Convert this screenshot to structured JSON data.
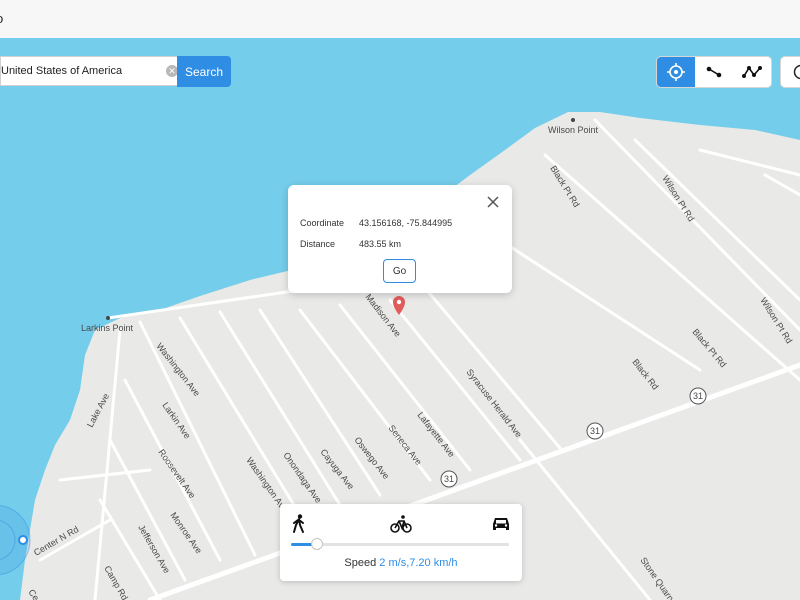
{
  "window": {
    "title_fragment": "o"
  },
  "search": {
    "value": "United States of America",
    "button_label": "Search"
  },
  "modes": {
    "items": [
      {
        "name": "teleport-mode",
        "icon": "crosshair-icon",
        "active": true
      },
      {
        "name": "two-spot-mode",
        "icon": "two-spot-route-icon",
        "active": false
      },
      {
        "name": "multi-spot-mode",
        "icon": "multi-spot-route-icon",
        "active": false
      }
    ]
  },
  "popup": {
    "coordinate_label": "Coordinate",
    "coordinate_value": "43.156168, -75.844995",
    "distance_label": "Distance",
    "distance_value": "483.55 km",
    "go_label": "Go"
  },
  "speed": {
    "label": "Speed",
    "value": "2 m/s,7.20 km/h",
    "slider_fraction": 0.12,
    "icons": [
      "walking-icon",
      "cycling-icon",
      "car-icon"
    ]
  },
  "map": {
    "labels": {
      "wilson_point": "Wilson Point",
      "larkins_point": "Larkins Point",
      "black_pt_rd": "Black Pt Rd",
      "wilson_pt_rd": "Wilson Pt Rd",
      "black_rd": "Black Rd",
      "madison_ave": "Madison Ave",
      "syracuse_herald_ave": "Syracuse Herald Ave",
      "lafayette_ave": "Lafayette Ave",
      "seneca_ave": "Seneca Ave",
      "oswego_ave": "Oswego Ave",
      "cayuga_ave": "Cayuga Ave",
      "onondaga_ave": "Onondaga Ave",
      "washington_ave": "Washington Ave",
      "larkin_ave": "Larkin Ave",
      "roosevelt_ave": "Roosevelt Ave",
      "monroe_ave": "Monroe Ave",
      "jefferson_ave": "Jefferson Ave",
      "lake_ave": "Lake Ave",
      "center_n_rd": "Center N Rd",
      "camp_rd": "Camp Rd",
      "stone_quarry": "Stone Quarry",
      "route_31": "31",
      "edge_partial": "Ce"
    },
    "colors": {
      "water": "#74cdea",
      "land": "#e9e9e7",
      "road": "#ffffff",
      "accent": "#2f8de4",
      "pin": "#e15b5b"
    }
  }
}
